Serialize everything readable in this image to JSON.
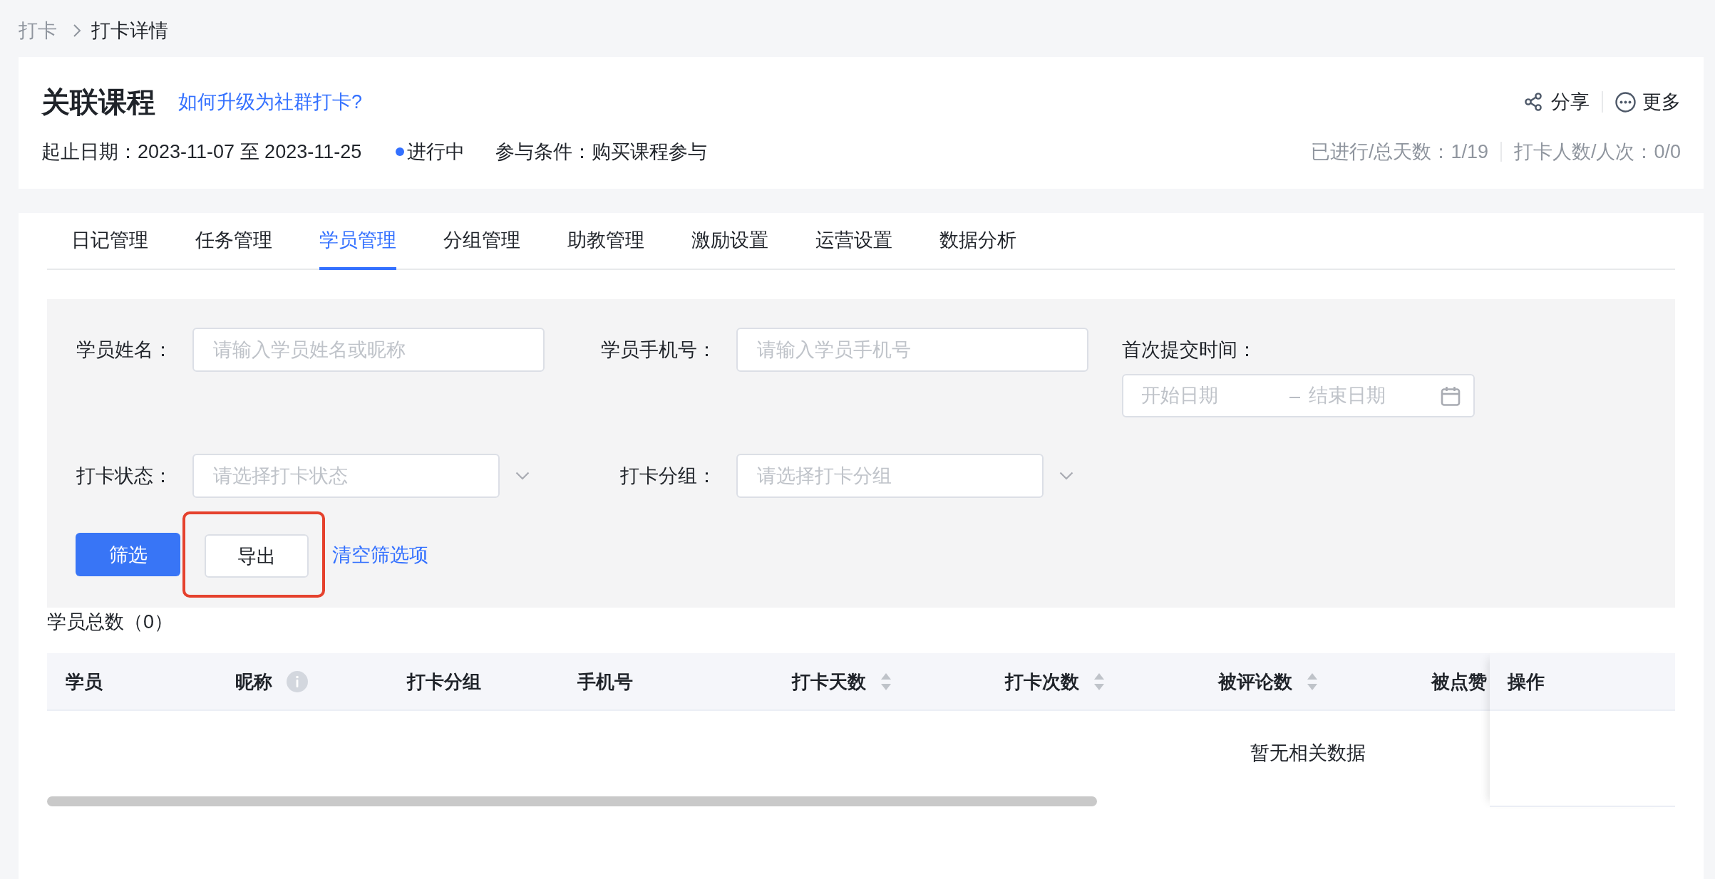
{
  "breadcrumb": [
    {
      "label": "打卡",
      "current": false
    },
    {
      "label": "打卡详情",
      "current": true
    }
  ],
  "header": {
    "title": "关联课程",
    "help_link": "如何升级为社群打卡?",
    "actions": [
      {
        "label": "分享",
        "kind": "share"
      },
      {
        "label": "更多",
        "kind": "more"
      }
    ],
    "date_range": "起止日期：2023-11-07 至 2023-11-25",
    "status": "进行中",
    "condition": "参与条件：购买课程参与",
    "stats": [
      "已进行/总天数：1/19",
      "打卡人数/人次：0/0"
    ]
  },
  "tabs": [
    {
      "label": "日记管理",
      "selected": false
    },
    {
      "label": "任务管理",
      "selected": false
    },
    {
      "label": "学员管理",
      "selected": true
    },
    {
      "label": "分组管理",
      "selected": false
    },
    {
      "label": "助教管理",
      "selected": false
    },
    {
      "label": "激励设置",
      "selected": false
    },
    {
      "label": "运营设置",
      "selected": false
    },
    {
      "label": "数据分析",
      "selected": false
    }
  ],
  "filters": [
    {
      "kind": "text",
      "label": "学员姓名：",
      "placeholder": "请输入学员姓名或昵称"
    },
    {
      "kind": "text",
      "label": "学员手机号：",
      "placeholder": "请输入学员手机号"
    },
    {
      "kind": "date_range",
      "label": "首次提交时间：",
      "start_placeholder": "开始日期",
      "separator": "–",
      "end_placeholder": "结束日期"
    },
    {
      "kind": "select",
      "label": "打卡状态：",
      "placeholder": "请选择打卡状态"
    },
    {
      "kind": "select",
      "label": "打卡分组：",
      "placeholder": "请选择打卡分组"
    }
  ],
  "buttons": [
    {
      "label": "筛选",
      "kind": "primary",
      "highlighted": false
    },
    {
      "label": "导出",
      "kind": "default",
      "highlighted": true
    },
    {
      "label": "清空筛选项",
      "kind": "link",
      "highlighted": false
    }
  ],
  "table": {
    "total": "学员总数（0）",
    "columns": [
      {
        "label": "学员",
        "kind": "plain"
      },
      {
        "label": "昵称",
        "kind": "info"
      },
      {
        "label": "打卡分组",
        "kind": "plain"
      },
      {
        "label": "手机号",
        "kind": "plain"
      },
      {
        "label": "打卡天数",
        "kind": "sortable"
      },
      {
        "label": "打卡次数",
        "kind": "sortable"
      },
      {
        "label": "被评论数",
        "kind": "sortable"
      },
      {
        "label": "被点赞",
        "kind": "plain"
      }
    ],
    "pinned_column": "操作",
    "empty_text": "暂无相关数据"
  }
}
